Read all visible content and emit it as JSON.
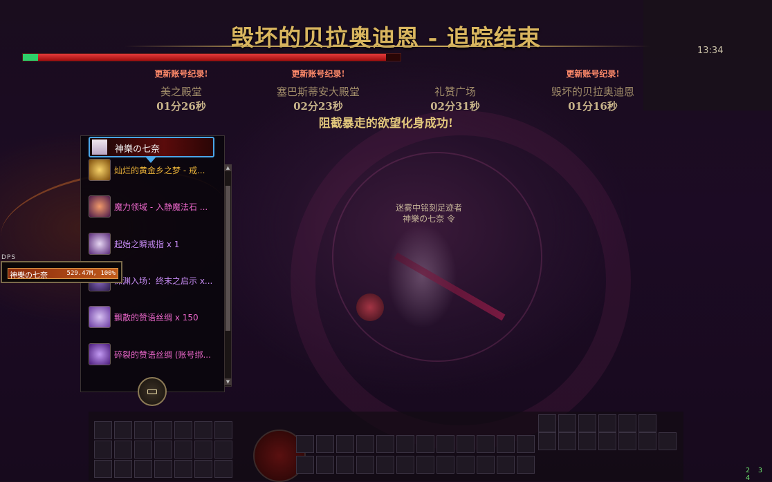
{
  "title": "毁坏的贝拉奥迪恩 - 追踪结束",
  "boss_hp": {
    "remaining_percent": 4
  },
  "records": [
    {
      "update_label": "更新账号纪录!",
      "name": "美之殿堂",
      "time": "01分26秒"
    },
    {
      "update_label": "更新账号纪录!",
      "name": "塞巴斯蒂安大殿堂",
      "time": "02分23秒"
    },
    {
      "update_label": "",
      "name": "礼赞广场",
      "time": "02分31秒"
    },
    {
      "update_label": "更新账号纪录!",
      "name": "毁坏的贝拉奥迪恩",
      "time": "01分16秒"
    }
  ],
  "success_message": "阻截暴走的欲望化身成功!",
  "top_right": {
    "clock": "13:34"
  },
  "loot": {
    "player_name": "神樂の七奈",
    "items": [
      {
        "label": "灿烂的黄金乡之梦 - 戒...",
        "rarity": "gold",
        "icon": "gold-ring-icon"
      },
      {
        "label": "魔力领域 - 入静魔法石 ...",
        "rarity": "pink",
        "icon": "magic-stone-icon"
      },
      {
        "label": "起始之瞬戒指 x 1",
        "rarity": "purple",
        "icon": "ring-icon"
      },
      {
        "label": "深渊入场：终末之启示 x...",
        "rarity": "purple",
        "icon": "abyss-ticket-icon"
      },
      {
        "label": "飘散的赞语丝绸 x 150",
        "rarity": "pink",
        "icon": "silk-icon"
      },
      {
        "label": "碎裂的赞语丝绸 (账号绑...",
        "rarity": "pink",
        "icon": "torn-silk-icon"
      }
    ],
    "chest_button_icon": "chest-icon"
  },
  "dps": {
    "tag": "DPS",
    "rows": [
      {
        "name": "神樂の七奈",
        "value": "529.47M, 100%"
      }
    ]
  },
  "npc": {
    "title_line1": "迷雾中铭刻足迹者",
    "title_line2": "神樂の七奈 令"
  },
  "fps": "2 3 4",
  "colors": {
    "gold_title": "#d9b65f",
    "hp_red": "#e23a3a",
    "hp_green": "#2ed06a",
    "rarity_gold": "#f2b83a",
    "rarity_purple": "#c58af2",
    "rarity_pink": "#e866c8"
  }
}
